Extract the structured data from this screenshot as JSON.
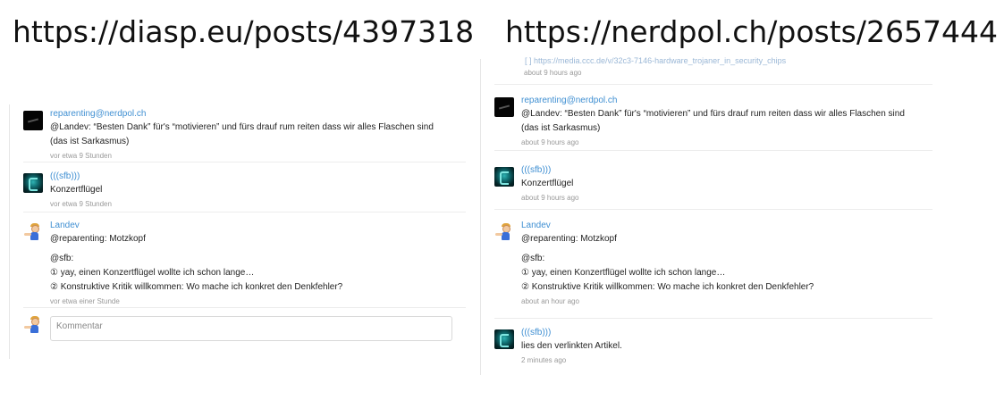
{
  "left": {
    "url": "https://diasp.eu/posts/4397318",
    "comments": [
      {
        "author": "reparenting@nerdpol.ch",
        "lines": [
          "@Landev: “Besten Dank” für's “motivieren” und fürs drauf rum reiten dass wir alles Flaschen sind",
          "(das ist Sarkasmus)"
        ],
        "time": "vor etwa 9 Stunden",
        "avatar": "black"
      },
      {
        "author": "(((sfb)))",
        "lines": [
          "Konzertflügel"
        ],
        "time": "vor etwa 9 Stunden",
        "avatar": "teal"
      },
      {
        "author": "Landev",
        "line1": "@reparenting: Motzkopf",
        "line2": "@sfb:",
        "line3": "① yay, einen Konzertflügel wollte ich schon lange…",
        "line4": "② Konstruktive Kritik willkommen: Wo mache ich konkret den Denkfehler?",
        "time": "vor etwa einer Stunde",
        "avatar": "person"
      }
    ],
    "comment_placeholder": "Kommentar"
  },
  "right": {
    "url": "https://nerdpol.ch/posts/2657444",
    "cut_text": "[ ] https://media.ccc.de/v/32c3-7146-hardware_trojaner_in_security_chips",
    "cut_time": "about 9 hours ago",
    "comments": [
      {
        "author": "reparenting@nerdpol.ch",
        "lines": [
          "@Landev: “Besten Dank” für's “motivieren” und fürs drauf rum reiten dass wir alles Flaschen sind",
          "(das ist Sarkasmus)"
        ],
        "time": "about 9 hours ago",
        "avatar": "black"
      },
      {
        "author": "(((sfb)))",
        "lines": [
          "Konzertflügel"
        ],
        "time": "about 9 hours ago",
        "avatar": "teal"
      },
      {
        "author": "Landev",
        "line1": "@reparenting: Motzkopf",
        "line2": "@sfb:",
        "line3": "① yay, einen Konzertflügel wollte ich schon lange…",
        "line4": "② Konstruktive Kritik willkommen: Wo mache ich konkret den Denkfehler?",
        "time": "about an hour ago",
        "avatar": "person"
      },
      {
        "author": "(((sfb)))",
        "lines": [
          "lies den verlinkten Artikel."
        ],
        "time": "2 minutes ago",
        "avatar": "teal"
      }
    ]
  }
}
